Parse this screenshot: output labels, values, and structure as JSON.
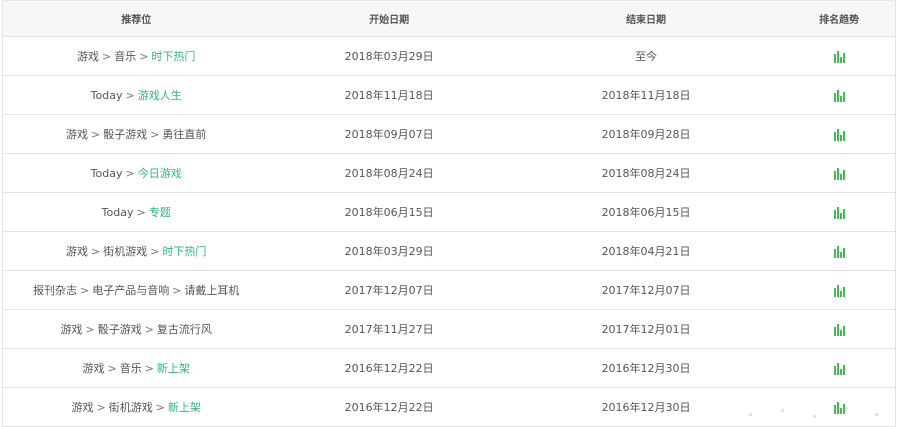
{
  "table": {
    "headers": [
      "推荐位",
      "开始日期",
      "结束日期",
      "排名趋势"
    ],
    "rows": [
      {
        "path": [
          "游戏",
          "音乐"
        ],
        "leaf": "时下热门",
        "leaf_link": true,
        "start": "2018年03月29日",
        "end": "至今"
      },
      {
        "path": [
          "Today"
        ],
        "leaf": "游戏人生",
        "leaf_link": true,
        "start": "2018年11月18日",
        "end": "2018年11月18日"
      },
      {
        "path": [
          "游戏",
          "骰子游戏"
        ],
        "leaf": "勇往直前",
        "leaf_link": false,
        "start": "2018年09月07日",
        "end": "2018年09月28日"
      },
      {
        "path": [
          "Today"
        ],
        "leaf": "今日游戏",
        "leaf_link": true,
        "start": "2018年08月24日",
        "end": "2018年08月24日"
      },
      {
        "path": [
          "Today"
        ],
        "leaf": "专题",
        "leaf_link": true,
        "start": "2018年06月15日",
        "end": "2018年06月15日"
      },
      {
        "path": [
          "游戏",
          "街机游戏"
        ],
        "leaf": "时下热门",
        "leaf_link": true,
        "start": "2018年03月29日",
        "end": "2018年04月21日"
      },
      {
        "path": [
          "报刊杂志",
          "电子产品与音响"
        ],
        "leaf": "请戴上耳机",
        "leaf_link": false,
        "start": "2017年12月07日",
        "end": "2017年12月07日"
      },
      {
        "path": [
          "游戏",
          "骰子游戏"
        ],
        "leaf": "复古流行风",
        "leaf_link": false,
        "start": "2017年11月27日",
        "end": "2017年12月01日"
      },
      {
        "path": [
          "游戏",
          "音乐"
        ],
        "leaf": "新上架",
        "leaf_link": true,
        "start": "2016年12月22日",
        "end": "2016年12月30日"
      },
      {
        "path": [
          "游戏",
          "街机游戏"
        ],
        "leaf": "新上架",
        "leaf_link": true,
        "start": "2016年12月22日",
        "end": "2016年12月30日"
      }
    ],
    "separator": ">",
    "trend_icon": "bar-chart-icon"
  },
  "colors": {
    "link": "#2fb879",
    "trend_icon": "#42bc55",
    "header_bg": "#f7f7f7",
    "border": "#e3e3e3"
  }
}
